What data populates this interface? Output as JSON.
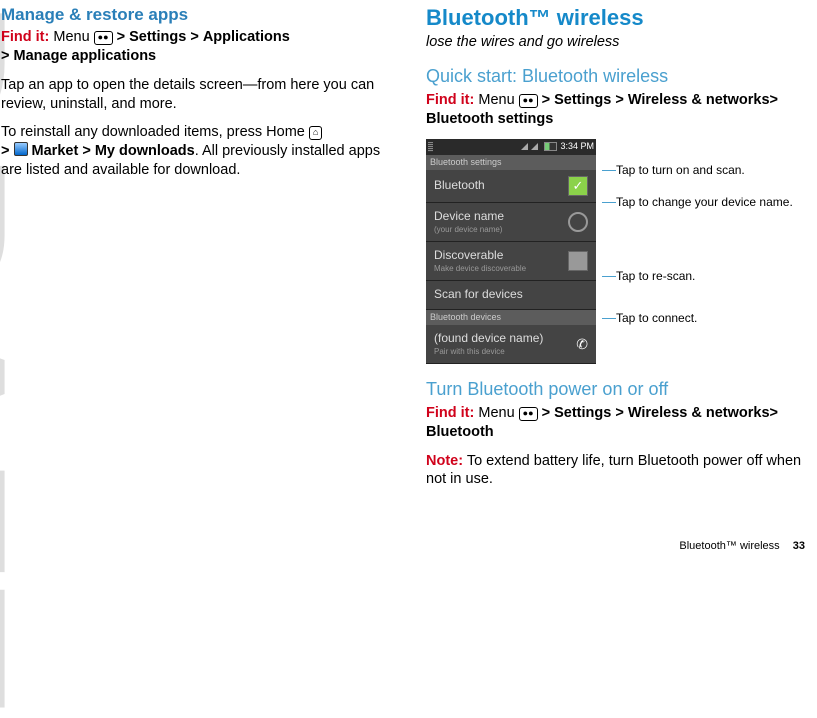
{
  "watermark": "DRAFT",
  "left": {
    "heading": "Manage & restore apps",
    "findit_label": "Find it:",
    "finditPath": {
      "a": "Menu",
      "sep": ">",
      "settings": "Settings",
      "apps": "Applications",
      "manage": "Manage applications"
    },
    "body1": "Tap an app to open the details screen—from here you can review, uninstall, and more.",
    "body2a": "To reinstall any downloaded items, press Home",
    "body2_market": "Market",
    "body2_mydl": "My downloads",
    "body2b": ". All previously installed apps are listed and available for download."
  },
  "right": {
    "heading": "Bluetooth™ wireless",
    "tagline": "lose the wires and go wireless",
    "quick": {
      "title": "Quick start: Bluetooth wireless",
      "findit_label": "Find it:",
      "menu": "Menu",
      "sep": ">",
      "settings": "Settings",
      "wn": "Wireless & networks",
      "bs": "Bluetooth settings"
    },
    "phone": {
      "time": "3:34 PM",
      "title": "Bluetooth settings",
      "rows": {
        "bluetooth": "Bluetooth",
        "devname": "Device name",
        "devname_sub": "(your device name)",
        "discoverable": "Discoverable",
        "discoverable_sub": "Make device discoverable",
        "scan": "Scan for devices",
        "btdev_header": "Bluetooth devices",
        "found": "(found device name)",
        "found_sub": "Pair with this device"
      }
    },
    "callouts": {
      "c1": "Tap to turn on and scan.",
      "c2": "Tap to change your device name.",
      "c3": "Tap to re-scan.",
      "c4": "Tap to connect."
    },
    "turn": {
      "title": "Turn Bluetooth power on or off",
      "findit_label": "Find it:",
      "menu": "Menu",
      "sep": ">",
      "settings": "Settings",
      "wn": "Wireless & networks",
      "bt": "Bluetooth",
      "note_label": "Note:",
      "note": "To extend battery life, turn Bluetooth power off when not in use."
    }
  },
  "footer": {
    "section": "Bluetooth™ wireless",
    "page": "33"
  }
}
